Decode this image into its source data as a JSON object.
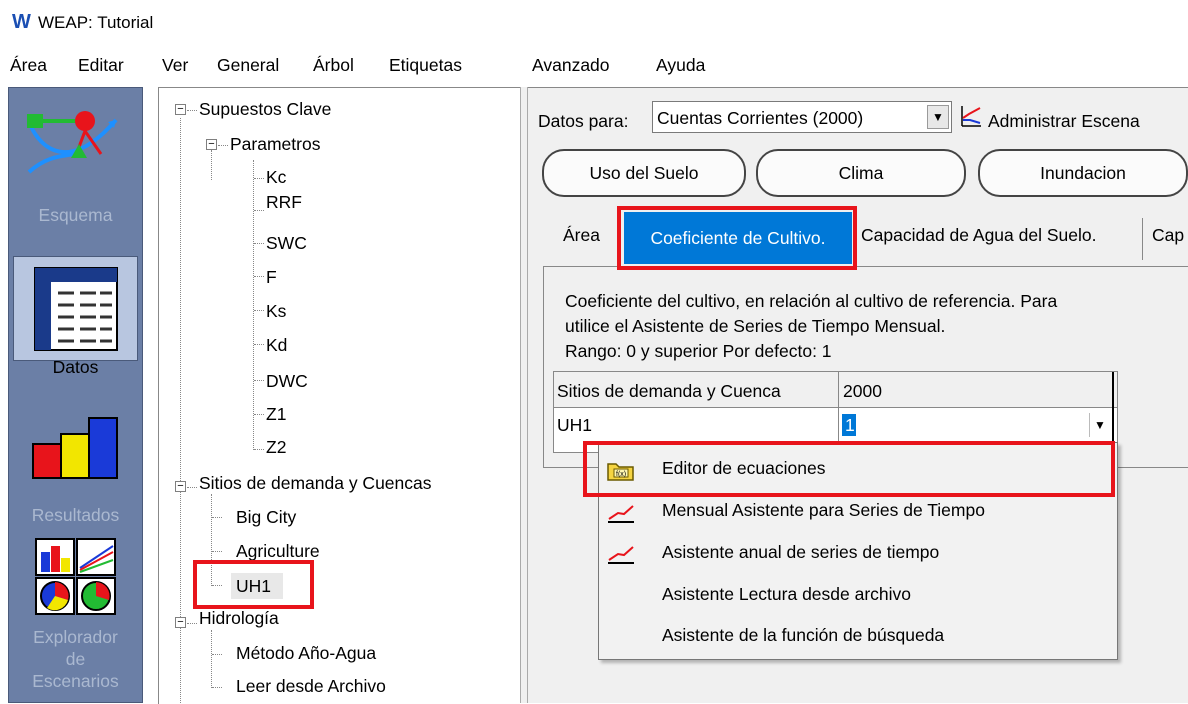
{
  "window": {
    "logo": "W",
    "title": "WEAP: Tutorial"
  },
  "menu": [
    "Área",
    "Editar",
    "Ver",
    "General",
    "Árbol",
    "Etiquetas",
    "Avanzado",
    "Ayuda"
  ],
  "iconbar": {
    "schema_label": "Esquema",
    "data_label": "Datos",
    "results_label": "Resultados",
    "explorer_label": [
      "Explorador",
      "de",
      "Escenarios"
    ]
  },
  "tree": {
    "key_assumptions": "Supuestos Clave",
    "parameters": "Parametros",
    "params": [
      "Kc",
      "RRF",
      "SWC",
      "F",
      "Ks",
      "Kd",
      "DWC",
      "Z1",
      "Z2"
    ],
    "demand_sites": "Sitios de demanda y Cuencas",
    "sites": [
      "Big City",
      "Agriculture",
      "UH1"
    ],
    "hydrology": "Hidrología",
    "hydro_items": [
      "Método Año-Agua",
      "Leer desde Archivo"
    ]
  },
  "data_panel": {
    "data_for_label": "Datos para:",
    "scenario_value": "Cuentas Corrientes (2000)",
    "manage_label": "Administrar Escena",
    "categories": [
      "Uso del Suelo",
      "Clima",
      "Inundacion"
    ],
    "tabs": [
      "Área",
      "Coeficiente de Cultivo.",
      "Capacidad de Agua del Suelo.",
      "Cap"
    ],
    "selected_tab": "Coeficiente de Cultivo.",
    "description": [
      "Coeficiente del cultivo, en relación al cultivo de referencia. Para",
      "utilice el Asistente de Series de Tiempo Mensual.",
      "Rango: 0 y superior   Por defecto: 1"
    ],
    "grid": {
      "header_col1": "Sitios de demanda y Cuenca",
      "header_col2": "2000",
      "row_name": "UH1",
      "row_value": "1"
    }
  },
  "context_menu": {
    "items": [
      {
        "label": "Editor de ecuaciones",
        "icon": "folder-equation-icon"
      },
      {
        "label": "Mensual Asistente para Series de Tiempo",
        "icon": "line-graph-icon"
      },
      {
        "label": "Asistente anual de series de tiempo",
        "icon": "line-graph-icon"
      },
      {
        "label": "Asistente Lectura desde archivo",
        "icon": ""
      },
      {
        "label": "Asistente de la función de búsqueda",
        "icon": ""
      }
    ]
  },
  "colors": {
    "highlight_red": "#e8141b",
    "selection_blue": "#0078d7",
    "iconbar_bg": "#6b7fa6"
  }
}
